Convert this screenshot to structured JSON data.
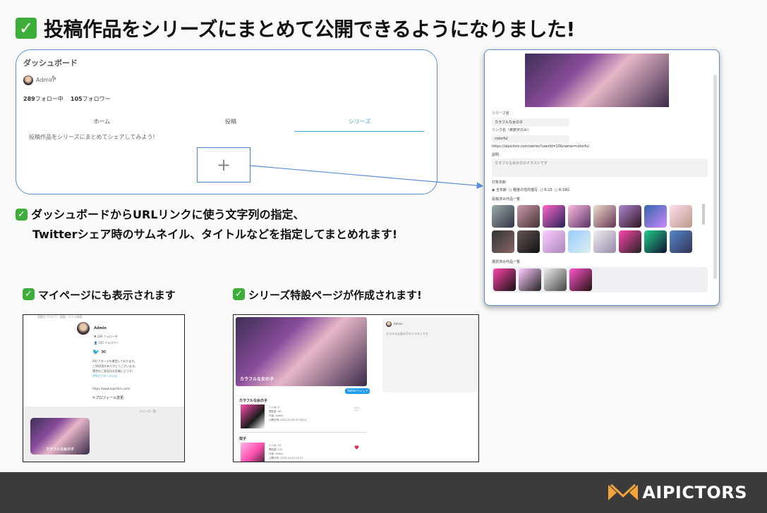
{
  "header": {
    "title": "投稿作品をシリーズにまとめて公開できるようになりました!"
  },
  "dashboard": {
    "title": "ダッシュボード",
    "user": "Admin",
    "following_count": "289",
    "following_label": "フォロー中",
    "followers_count": "105",
    "followers_label": "フォロワー",
    "tabs": [
      {
        "label": "ホーム",
        "active": false
      },
      {
        "label": "投稿",
        "active": false
      },
      {
        "label": "シリーズ",
        "active": true
      }
    ],
    "hint": "投稿作品をシリーズにまとめてシェアしてみよう!",
    "add_symbol": "+"
  },
  "notes": {
    "note1_line1": "ダッシュボードからURLリンクに使う文字列の指定、",
    "note1_line2": "Twitterシェア時のサムネイル、タイトルなどを指定してまとめれます!",
    "note2": "マイページにも表示されます",
    "note3": "シリーズ特設ページが作成されます!"
  },
  "editor": {
    "series_name_label": "シリーズ名",
    "series_name_value": "カラフルな女の子",
    "link_label": "リンク名（英数字のみ）",
    "link_value": "colorful",
    "url": "https://aipictors.com/series?userId=10&name=colorful",
    "description_label": "説明",
    "description_value": "カラフルな女の子のイラストです",
    "age_label": "対象年齢",
    "age_options": [
      "全年齢",
      "軽度の性的描写",
      "R-15",
      "R-18G"
    ],
    "works_label": "投稿済み作品一覧",
    "selected_label": "選択済み作品一覧"
  },
  "mypage": {
    "top_text": "図鑑をブログで、図鑑、ホテル検索",
    "name": "Admin",
    "stat1": "289 フォロー中",
    "stat2": "105 フォロワー",
    "bio_lines": [
      "AIピクターズを運営しております。",
      "ご利用頂きありがとうございます。",
      "運営のご意見はお気軽にどうぞ。",
      "#AIピクターズ公式"
    ],
    "url": "https://www.aipictors.com/",
    "edit_label": "プロフィール変更",
    "series_label": "シリーズ一覧",
    "series_card_title": "カラフルな女の子"
  },
  "series_page": {
    "hero_title": "カラフルな女の子",
    "twitter_button": "Twitterでシェア",
    "side_user": "Admin",
    "side_desc": "カラフルな女の子のイラストです",
    "items": [
      {
        "title": "カラフルな女の子",
        "meta1": "いいね: 4",
        "meta2": "閲覧数: 49",
        "meta3": "作者: Admin",
        "meta4": "公開日時: 2023-11-08 07:56:21",
        "liked": false
      },
      {
        "title": "双子",
        "meta1": "いいね: 10",
        "meta2": "閲覧数: 122",
        "meta3": "作者: Admin",
        "meta4": "公開日時: 2023-10-10 13:13",
        "liked": true
      }
    ]
  },
  "footer": {
    "logo_text": "AIPICTORS"
  },
  "colors": {
    "check_green": "#3dae3a",
    "accent_blue": "#3aa6dc",
    "frame_blue": "#5b8ed6",
    "footer_bg": "#3b3b3c",
    "logo_orange": "#f2a33a"
  }
}
